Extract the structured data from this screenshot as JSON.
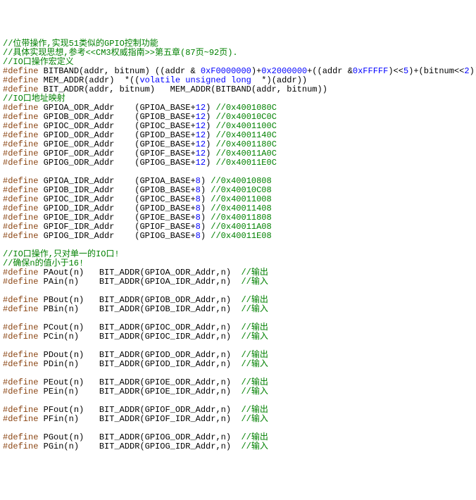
{
  "lines": [
    {
      "segments": [
        {
          "cls": "comment",
          "text": "//位带操作,实现51类似的GPIO控制功能"
        }
      ]
    },
    {
      "segments": [
        {
          "cls": "comment",
          "text": "//具体实现思想,参考<<CM3权威指南>>第五章(87页~92页)."
        }
      ]
    },
    {
      "segments": [
        {
          "cls": "comment",
          "text": "//IO口操作宏定义"
        }
      ]
    },
    {
      "segments": [
        {
          "cls": "keyword",
          "text": "#define"
        },
        {
          "cls": "identifier",
          "text": " BITBAND(addr, bitnum) ((addr & "
        },
        {
          "cls": "number",
          "text": "0xF0000000"
        },
        {
          "cls": "identifier",
          "text": ")+"
        },
        {
          "cls": "number",
          "text": "0x2000000"
        },
        {
          "cls": "identifier",
          "text": "+((addr &"
        },
        {
          "cls": "number",
          "text": "0xFFFFF"
        },
        {
          "cls": "identifier",
          "text": ")<<"
        },
        {
          "cls": "number",
          "text": "5"
        },
        {
          "cls": "identifier",
          "text": ")+(bitnum<<"
        },
        {
          "cls": "number",
          "text": "2"
        },
        {
          "cls": "identifier",
          "text": "))"
        }
      ]
    },
    {
      "segments": [
        {
          "cls": "keyword",
          "text": "#define"
        },
        {
          "cls": "identifier",
          "text": " MEM_ADDR(addr)  *(("
        },
        {
          "cls": "type",
          "text": "volatile unsigned long"
        },
        {
          "cls": "identifier",
          "text": "  *)(addr))"
        }
      ]
    },
    {
      "segments": [
        {
          "cls": "keyword",
          "text": "#define"
        },
        {
          "cls": "identifier",
          "text": " BIT_ADDR(addr, bitnum)   MEM_ADDR(BITBAND(addr, bitnum))"
        }
      ]
    },
    {
      "segments": [
        {
          "cls": "comment",
          "text": "//IO口地址映射"
        }
      ]
    },
    {
      "segments": [
        {
          "cls": "keyword",
          "text": "#define"
        },
        {
          "cls": "identifier",
          "text": " GPIOA_ODR_Addr    (GPIOA_BASE+"
        },
        {
          "cls": "number",
          "text": "12"
        },
        {
          "cls": "identifier",
          "text": ") "
        },
        {
          "cls": "comment",
          "text": "//0x4001080C"
        }
      ]
    },
    {
      "segments": [
        {
          "cls": "keyword",
          "text": "#define"
        },
        {
          "cls": "identifier",
          "text": " GPIOB_ODR_Addr    (GPIOB_BASE+"
        },
        {
          "cls": "number",
          "text": "12"
        },
        {
          "cls": "identifier",
          "text": ") "
        },
        {
          "cls": "comment",
          "text": "//0x40010C0C"
        }
      ]
    },
    {
      "segments": [
        {
          "cls": "keyword",
          "text": "#define"
        },
        {
          "cls": "identifier",
          "text": " GPIOC_ODR_Addr    (GPIOC_BASE+"
        },
        {
          "cls": "number",
          "text": "12"
        },
        {
          "cls": "identifier",
          "text": ") "
        },
        {
          "cls": "comment",
          "text": "//0x4001100C"
        }
      ]
    },
    {
      "segments": [
        {
          "cls": "keyword",
          "text": "#define"
        },
        {
          "cls": "identifier",
          "text": " GPIOD_ODR_Addr    (GPIOD_BASE+"
        },
        {
          "cls": "number",
          "text": "12"
        },
        {
          "cls": "identifier",
          "text": ") "
        },
        {
          "cls": "comment",
          "text": "//0x4001140C"
        }
      ]
    },
    {
      "segments": [
        {
          "cls": "keyword",
          "text": "#define"
        },
        {
          "cls": "identifier",
          "text": " GPIOE_ODR_Addr    (GPIOE_BASE+"
        },
        {
          "cls": "number",
          "text": "12"
        },
        {
          "cls": "identifier",
          "text": ") "
        },
        {
          "cls": "comment",
          "text": "//0x4001180C"
        }
      ]
    },
    {
      "segments": [
        {
          "cls": "keyword",
          "text": "#define"
        },
        {
          "cls": "identifier",
          "text": " GPIOF_ODR_Addr    (GPIOF_BASE+"
        },
        {
          "cls": "number",
          "text": "12"
        },
        {
          "cls": "identifier",
          "text": ") "
        },
        {
          "cls": "comment",
          "text": "//0x40011A0C"
        }
      ]
    },
    {
      "segments": [
        {
          "cls": "keyword",
          "text": "#define"
        },
        {
          "cls": "identifier",
          "text": " GPIOG_ODR_Addr    (GPIOG_BASE+"
        },
        {
          "cls": "number",
          "text": "12"
        },
        {
          "cls": "identifier",
          "text": ") "
        },
        {
          "cls": "comment",
          "text": "//0x40011E0C"
        }
      ]
    },
    {
      "segments": []
    },
    {
      "segments": [
        {
          "cls": "keyword",
          "text": "#define"
        },
        {
          "cls": "identifier",
          "text": " GPIOA_IDR_Addr    (GPIOA_BASE+"
        },
        {
          "cls": "number",
          "text": "8"
        },
        {
          "cls": "identifier",
          "text": ") "
        },
        {
          "cls": "comment",
          "text": "//0x40010808"
        }
      ]
    },
    {
      "segments": [
        {
          "cls": "keyword",
          "text": "#define"
        },
        {
          "cls": "identifier",
          "text": " GPIOB_IDR_Addr    (GPIOB_BASE+"
        },
        {
          "cls": "number",
          "text": "8"
        },
        {
          "cls": "identifier",
          "text": ") "
        },
        {
          "cls": "comment",
          "text": "//0x40010C08"
        }
      ]
    },
    {
      "segments": [
        {
          "cls": "keyword",
          "text": "#define"
        },
        {
          "cls": "identifier",
          "text": " GPIOC_IDR_Addr    (GPIOC_BASE+"
        },
        {
          "cls": "number",
          "text": "8"
        },
        {
          "cls": "identifier",
          "text": ") "
        },
        {
          "cls": "comment",
          "text": "//0x40011008"
        }
      ]
    },
    {
      "segments": [
        {
          "cls": "keyword",
          "text": "#define"
        },
        {
          "cls": "identifier",
          "text": " GPIOD_IDR_Addr    (GPIOD_BASE+"
        },
        {
          "cls": "number",
          "text": "8"
        },
        {
          "cls": "identifier",
          "text": ") "
        },
        {
          "cls": "comment",
          "text": "//0x40011408"
        }
      ]
    },
    {
      "segments": [
        {
          "cls": "keyword",
          "text": "#define"
        },
        {
          "cls": "identifier",
          "text": " GPIOE_IDR_Addr    (GPIOE_BASE+"
        },
        {
          "cls": "number",
          "text": "8"
        },
        {
          "cls": "identifier",
          "text": ") "
        },
        {
          "cls": "comment",
          "text": "//0x40011808"
        }
      ]
    },
    {
      "segments": [
        {
          "cls": "keyword",
          "text": "#define"
        },
        {
          "cls": "identifier",
          "text": " GPIOF_IDR_Addr    (GPIOF_BASE+"
        },
        {
          "cls": "number",
          "text": "8"
        },
        {
          "cls": "identifier",
          "text": ") "
        },
        {
          "cls": "comment",
          "text": "//0x40011A08"
        }
      ]
    },
    {
      "segments": [
        {
          "cls": "keyword",
          "text": "#define"
        },
        {
          "cls": "identifier",
          "text": " GPIOG_IDR_Addr    (GPIOG_BASE+"
        },
        {
          "cls": "number",
          "text": "8"
        },
        {
          "cls": "identifier",
          "text": ") "
        },
        {
          "cls": "comment",
          "text": "//0x40011E08"
        }
      ]
    },
    {
      "segments": []
    },
    {
      "segments": [
        {
          "cls": "comment",
          "text": "//IO口操作,只对单一的IO口!"
        }
      ]
    },
    {
      "segments": [
        {
          "cls": "comment",
          "text": "//确保n的值小于16!"
        }
      ]
    },
    {
      "segments": [
        {
          "cls": "keyword",
          "text": "#define"
        },
        {
          "cls": "identifier",
          "text": " PAout(n)   BIT_ADDR(GPIOA_ODR_Addr,n)  "
        },
        {
          "cls": "comment",
          "text": "//输出"
        }
      ]
    },
    {
      "segments": [
        {
          "cls": "keyword",
          "text": "#define"
        },
        {
          "cls": "identifier",
          "text": " PAin(n)    BIT_ADDR(GPIOA_IDR_Addr,n)  "
        },
        {
          "cls": "comment",
          "text": "//输入"
        }
      ]
    },
    {
      "segments": []
    },
    {
      "segments": [
        {
          "cls": "keyword",
          "text": "#define"
        },
        {
          "cls": "identifier",
          "text": " PBout(n)   BIT_ADDR(GPIOB_ODR_Addr,n)  "
        },
        {
          "cls": "comment",
          "text": "//输出"
        }
      ]
    },
    {
      "segments": [
        {
          "cls": "keyword",
          "text": "#define"
        },
        {
          "cls": "identifier",
          "text": " PBin(n)    BIT_ADDR(GPIOB_IDR_Addr,n)  "
        },
        {
          "cls": "comment",
          "text": "//输入"
        }
      ]
    },
    {
      "segments": []
    },
    {
      "segments": [
        {
          "cls": "keyword",
          "text": "#define"
        },
        {
          "cls": "identifier",
          "text": " PCout(n)   BIT_ADDR(GPIOC_ODR_Addr,n)  "
        },
        {
          "cls": "comment",
          "text": "//输出"
        }
      ]
    },
    {
      "segments": [
        {
          "cls": "keyword",
          "text": "#define"
        },
        {
          "cls": "identifier",
          "text": " PCin(n)    BIT_ADDR(GPIOC_IDR_Addr,n)  "
        },
        {
          "cls": "comment",
          "text": "//输入"
        }
      ]
    },
    {
      "segments": []
    },
    {
      "segments": [
        {
          "cls": "keyword",
          "text": "#define"
        },
        {
          "cls": "identifier",
          "text": " PDout(n)   BIT_ADDR(GPIOD_ODR_Addr,n)  "
        },
        {
          "cls": "comment",
          "text": "//输出"
        }
      ]
    },
    {
      "segments": [
        {
          "cls": "keyword",
          "text": "#define"
        },
        {
          "cls": "identifier",
          "text": " PDin(n)    BIT_ADDR(GPIOD_IDR_Addr,n)  "
        },
        {
          "cls": "comment",
          "text": "//输入"
        }
      ]
    },
    {
      "segments": []
    },
    {
      "segments": [
        {
          "cls": "keyword",
          "text": "#define"
        },
        {
          "cls": "identifier",
          "text": " PEout(n)   BIT_ADDR(GPIOE_ODR_Addr,n)  "
        },
        {
          "cls": "comment",
          "text": "//输出"
        }
      ]
    },
    {
      "segments": [
        {
          "cls": "keyword",
          "text": "#define"
        },
        {
          "cls": "identifier",
          "text": " PEin(n)    BIT_ADDR(GPIOE_IDR_Addr,n)  "
        },
        {
          "cls": "comment",
          "text": "//输入"
        }
      ]
    },
    {
      "segments": []
    },
    {
      "segments": [
        {
          "cls": "keyword",
          "text": "#define"
        },
        {
          "cls": "identifier",
          "text": " PFout(n)   BIT_ADDR(GPIOF_ODR_Addr,n)  "
        },
        {
          "cls": "comment",
          "text": "//输出"
        }
      ]
    },
    {
      "segments": [
        {
          "cls": "keyword",
          "text": "#define"
        },
        {
          "cls": "identifier",
          "text": " PFin(n)    BIT_ADDR(GPIOF_IDR_Addr,n)  "
        },
        {
          "cls": "comment",
          "text": "//输入"
        }
      ]
    },
    {
      "segments": []
    },
    {
      "segments": [
        {
          "cls": "keyword",
          "text": "#define"
        },
        {
          "cls": "identifier",
          "text": " PGout(n)   BIT_ADDR(GPIOG_ODR_Addr,n)  "
        },
        {
          "cls": "comment",
          "text": "//输出"
        }
      ]
    },
    {
      "segments": [
        {
          "cls": "keyword",
          "text": "#define"
        },
        {
          "cls": "identifier",
          "text": " PGin(n)    BIT_ADDR(GPIOG_IDR_Addr,n)  "
        },
        {
          "cls": "comment",
          "text": "//输入"
        }
      ]
    }
  ]
}
